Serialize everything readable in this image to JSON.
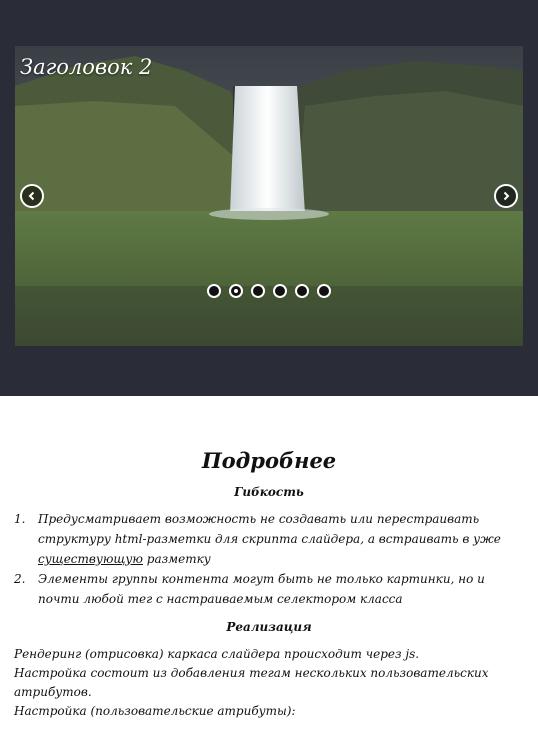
{
  "slider": {
    "slide_title": "Заголовок 2",
    "prev_icon": "chevron-left-icon",
    "next_icon": "chevron-right-icon",
    "total_slides": 6,
    "active_slide": 2,
    "colors": {
      "frame": "#2a2d38",
      "dot_fill": "#111111",
      "dot_border": "#ffffff"
    }
  },
  "details": {
    "title": "Подробнее",
    "flexibility_heading": "Гибкость",
    "features": [
      {
        "num": "1.",
        "text_a": "Предусматривает возможность не создавать или перестраивать структуру html-разметки для скрипта слайдера, а встраивать в уже ",
        "text_u": "существующую",
        "text_b": " разметку"
      },
      {
        "num": "2.",
        "text_a": "Элементы группы контента могут быть не только картинки, но и почти любой тег с настраиваемым селектором класса",
        "text_u": "",
        "text_b": ""
      }
    ],
    "implementation_heading": "Реализация",
    "paragraph_1": "Рендеринг (отрисовка) каркаса слайдера происходит через js.",
    "paragraph_2": "Настройка состоит из добавления тегам нескольких пользовательских атрибутов.",
    "paragraph_3": "Настройка (пользовательские атрибуты):"
  }
}
